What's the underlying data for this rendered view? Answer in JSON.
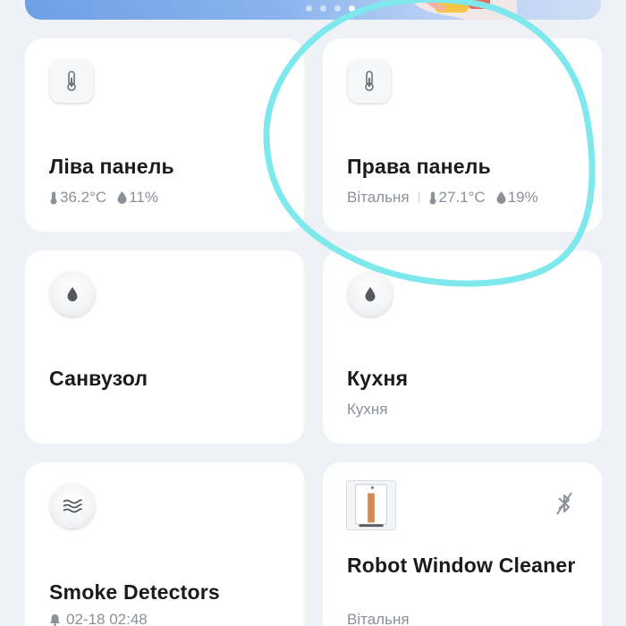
{
  "banner": {
    "dots": 4,
    "active_dot": 3
  },
  "devices": [
    {
      "name": "Ліва панель",
      "room": "",
      "temperature": "36.2°C",
      "humidity": "11%",
      "icon": "thermometer-icon"
    },
    {
      "name": "Права панель",
      "room": "Вітальня",
      "temperature": "27.1°C",
      "humidity": "19%",
      "icon": "thermometer-icon"
    },
    {
      "name": "Санвузол",
      "room": "",
      "icon": "water-drop-icon"
    },
    {
      "name": "Кухня",
      "room": "Кухня",
      "icon": "water-drop-icon"
    },
    {
      "name": "Smoke Detectors",
      "room": "",
      "last_alarm": "02-18 02:48",
      "icon": "smoke-waves-icon"
    },
    {
      "name": "Robot Window Cleaner",
      "room": "Вітальня",
      "icon": "robot-window-cleaner-image",
      "status_icon": "bluetooth-off-icon"
    }
  ],
  "annotation": {
    "color": "#7ee8ec"
  }
}
